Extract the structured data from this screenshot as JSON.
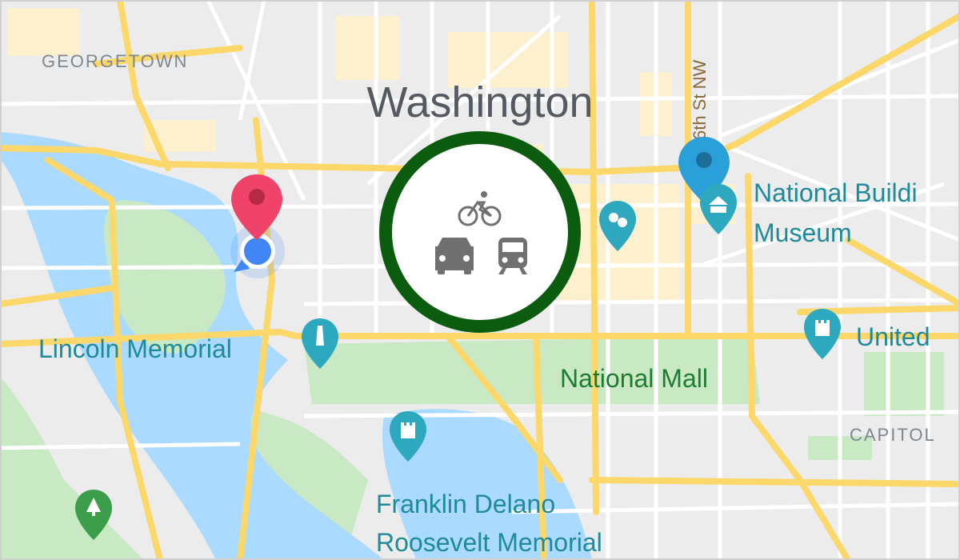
{
  "map": {
    "city_label": "Washington",
    "district_labels": {
      "georgetown": "GEORGETOWN",
      "capitol": "CAPITOL"
    },
    "street_label": "6th St NW",
    "places": {
      "national_building_museum": [
        "National Buildi",
        "Museum"
      ],
      "lincoln_memorial": "Lincoln Memorial",
      "national_mall": "National Mall",
      "united": "United",
      "fdr_memorial": [
        "Franklin Delano",
        "Roosevelt Memorial"
      ]
    }
  },
  "transport_modes": [
    "bicycle",
    "car",
    "train"
  ],
  "icons": {
    "transport_button": "transport-mode-icons",
    "pins": [
      "red-location-pin-icon",
      "blue-location-pin-icon",
      "current-location-dot-icon",
      "theater-icon",
      "museum-icon",
      "monument-icon",
      "castle-icon",
      "park-icon"
    ]
  },
  "colors": {
    "water": "#aadaff",
    "park": "#c8e9c3",
    "major_road": "#fbd869",
    "minor_road": "#ffffff",
    "poi_teal": "#2ea8bf",
    "selected_ring": "#0c5c10",
    "pin_red": "#f0436a",
    "pin_blue": "#2a9fd8",
    "current_location": "#4285f4",
    "park_label": "#1e7b32",
    "poi_label": "#1f8a9a"
  }
}
